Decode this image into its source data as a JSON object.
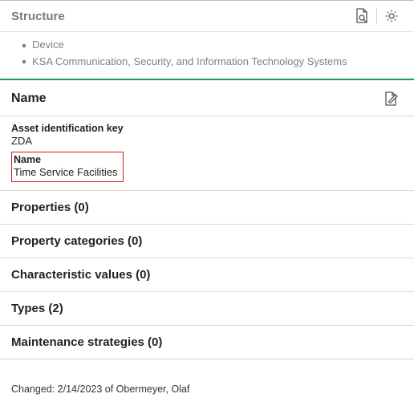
{
  "structure": {
    "title": "Structure",
    "tree": {
      "root": "Device",
      "child": "KSA Communication, Security, and Information Technology Systems"
    }
  },
  "nameSection": {
    "title": "Name",
    "fields": {
      "assetKeyLabel": "Asset identification key",
      "assetKeyValue": "ZDA",
      "nameLabel": "Name",
      "nameValue": "Time Service Facilities"
    }
  },
  "collapsibles": {
    "properties": "Properties (0)",
    "propertyCategories": "Property categories (0)",
    "characteristicValues": "Characteristic values (0)",
    "types": "Types (2)",
    "maintenanceStrategies": "Maintenance strategies (0)"
  },
  "footer": {
    "changed": "Changed: 2/14/2023 of Obermeyer, Olaf"
  }
}
